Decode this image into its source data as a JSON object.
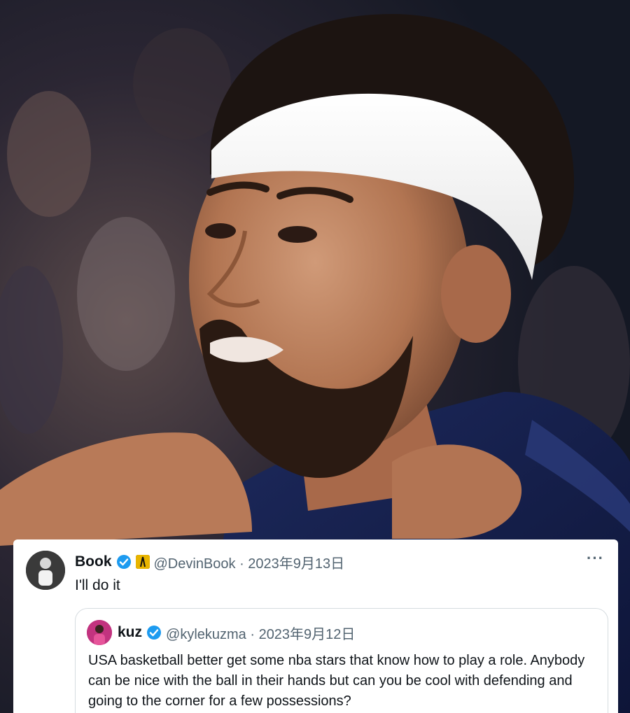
{
  "tweet": {
    "display_name": "Book",
    "handle_date": "@DevinBook · 2023年9月13日",
    "text": "I'll do it",
    "more_label": "···",
    "quoted": {
      "display_name": "kuz",
      "handle_date": "@kylekuzma · 2023年9月12日",
      "text": "USA basketball better get some nba stars that know how to play a role. Anybody can be nice with the ball in their hands but can you be cool with defending and going to the corner for a few possessions?"
    }
  },
  "icons": {
    "avatar": "profile-photo",
    "verified": "verified-badge-icon",
    "affiliate": "affiliate-badge-icon",
    "more": "more-options-icon"
  },
  "colors": {
    "verified_blue": "#1d9bf0",
    "text_primary": "#0f1419",
    "text_secondary": "#536471",
    "card_bg": "#ffffff"
  }
}
